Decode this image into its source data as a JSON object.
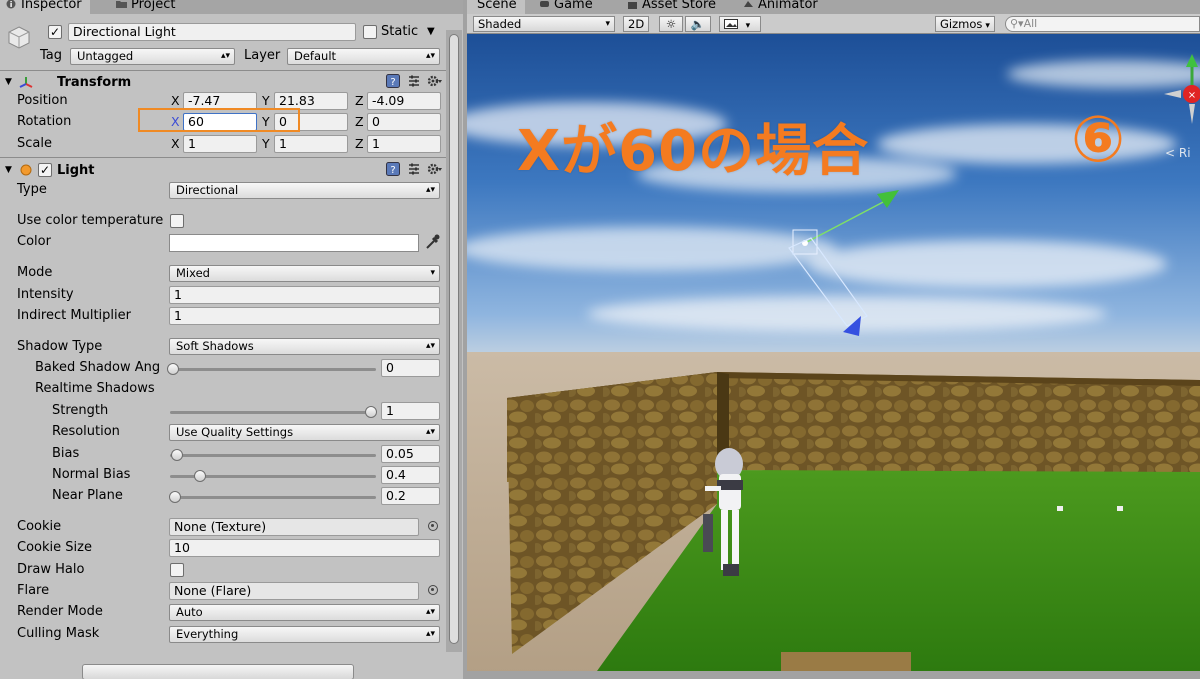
{
  "inspector": {
    "tabs": [
      {
        "label": "Inspector",
        "icon": "info-icon"
      },
      {
        "label": "Project",
        "icon": "folder-icon"
      }
    ],
    "object": {
      "name": "Directional Light",
      "active": true,
      "static_label": "Static",
      "static": false,
      "tag_label": "Tag",
      "tag_value": "Untagged",
      "layer_label": "Layer",
      "layer_value": "Default"
    },
    "transform": {
      "title": "Transform",
      "position_label": "Position",
      "rotation_label": "Rotation",
      "scale_label": "Scale",
      "axes": [
        "X",
        "Y",
        "Z"
      ],
      "position": [
        "-7.47",
        "21.83",
        "-4.09"
      ],
      "rotation": [
        "60",
        "0",
        "0"
      ],
      "scale": [
        "1",
        "1",
        "1"
      ]
    },
    "light": {
      "title": "Light",
      "enabled": true,
      "type_label": "Type",
      "type_value": "Directional",
      "use_color_temp_label": "Use color temperature",
      "color_label": "Color",
      "mode_label": "Mode",
      "mode_value": "Mixed",
      "intensity_label": "Intensity",
      "intensity_value": "1",
      "indirect_label": "Indirect Multiplier",
      "indirect_value": "1",
      "shadow_type_label": "Shadow Type",
      "shadow_type_value": "Soft Shadows",
      "baked_angle_label": "Baked Shadow Ang",
      "baked_angle_value": "0",
      "realtime_label": "Realtime Shadows",
      "strength_label": "Strength",
      "strength_value": "1",
      "resolution_label": "Resolution",
      "resolution_value": "Use Quality Settings",
      "bias_label": "Bias",
      "bias_value": "0.05",
      "normal_bias_label": "Normal Bias",
      "normal_bias_value": "0.4",
      "near_plane_label": "Near Plane",
      "near_plane_value": "0.2",
      "cookie_label": "Cookie",
      "cookie_value": "None (Texture)",
      "cookie_size_label": "Cookie Size",
      "cookie_size_value": "10",
      "draw_halo_label": "Draw Halo",
      "flare_label": "Flare",
      "flare_value": "None (Flare)",
      "render_mode_label": "Render Mode",
      "render_mode_value": "Auto",
      "culling_label": "Culling Mask",
      "culling_value": "Everything"
    }
  },
  "scene": {
    "tabs": [
      {
        "label": "Scene",
        "icon": "scene-icon"
      },
      {
        "label": "Game",
        "icon": "game-icon"
      },
      {
        "label": "Asset Store",
        "icon": "store-icon"
      },
      {
        "label": "Animator",
        "icon": "animator-icon"
      }
    ],
    "toolbar": {
      "shading": "Shaded",
      "mode_2d": "2D",
      "gizmos": "Gizmos",
      "search_placeholder": "All"
    },
    "overlay_text": "Xが60の場合",
    "overlay_number": "⑥",
    "gizmo_label": "< Ri"
  },
  "colors": {
    "highlight": "#f08a24",
    "overlay_text": "#f47b20",
    "axis_blue": "#3a4bd6"
  }
}
